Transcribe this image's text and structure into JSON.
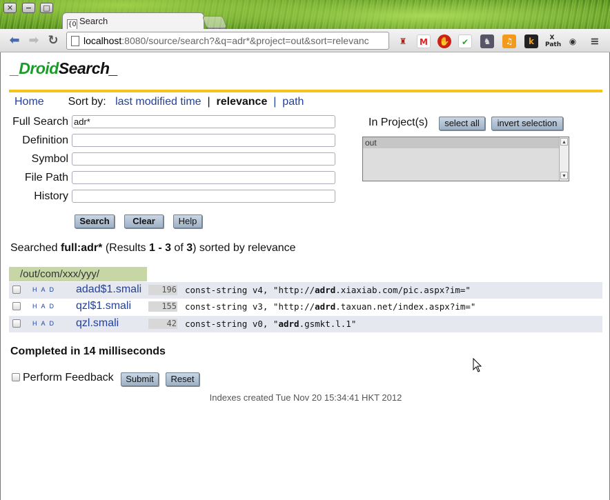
{
  "browser": {
    "tab_title": "Search",
    "tab_favicon": "{O",
    "url_host": "localhost",
    "url_rest": ":8080/source/search?&q=adr*&project=out&sort=relevanc"
  },
  "logo": {
    "prefix": "_Droid",
    "suffix": "Search_"
  },
  "menu": {
    "home": "Home",
    "sort_by": "Sort by:",
    "sort_options": [
      "last modified time",
      "relevance",
      "path"
    ],
    "separator": "|"
  },
  "form": {
    "full_search_label": "Full Search",
    "full_search_value": "adr*",
    "definition_label": "Definition",
    "symbol_label": "Symbol",
    "file_path_label": "File Path",
    "history_label": "History",
    "search_btn": "Search",
    "clear_btn": "Clear",
    "help_btn": "Help"
  },
  "projects": {
    "label": "In Project(s)",
    "select_all": "select all",
    "invert_selection": "invert selection",
    "options": [
      "out"
    ]
  },
  "summary": {
    "prefix": "Searched ",
    "query": "full:adr*",
    "results_prefix": " (Results ",
    "range": "1 - 3",
    "of": " of ",
    "total": "3",
    "suffix": ") sorted by relevance"
  },
  "results": {
    "directory": "/out/com/xxx/yyy/",
    "had": "H A D",
    "rows": [
      {
        "file": "adad$1.smali",
        "line": "196",
        "pre": "const-string v4, \"http://",
        "match": "adrd",
        "post": ".xiaxiab.com/pic.aspx?im=\""
      },
      {
        "file": "qzl$1.smali",
        "line": "155",
        "pre": "const-string v3, \"http://",
        "match": "adrd",
        "post": ".taxuan.net/index.aspx?im=\""
      },
      {
        "file": "qzl.smali",
        "line": "42",
        "pre": "const-string v0, \"",
        "match": "adrd",
        "post": ".gsmkt.l.1\""
      }
    ]
  },
  "completed": "Completed in 14 milliseconds",
  "feedback": {
    "label": "Perform Feedback",
    "submit": "Submit",
    "reset": "Reset"
  },
  "footer": "Indexes created Tue Nov 20 15:34:41 HKT 2012"
}
